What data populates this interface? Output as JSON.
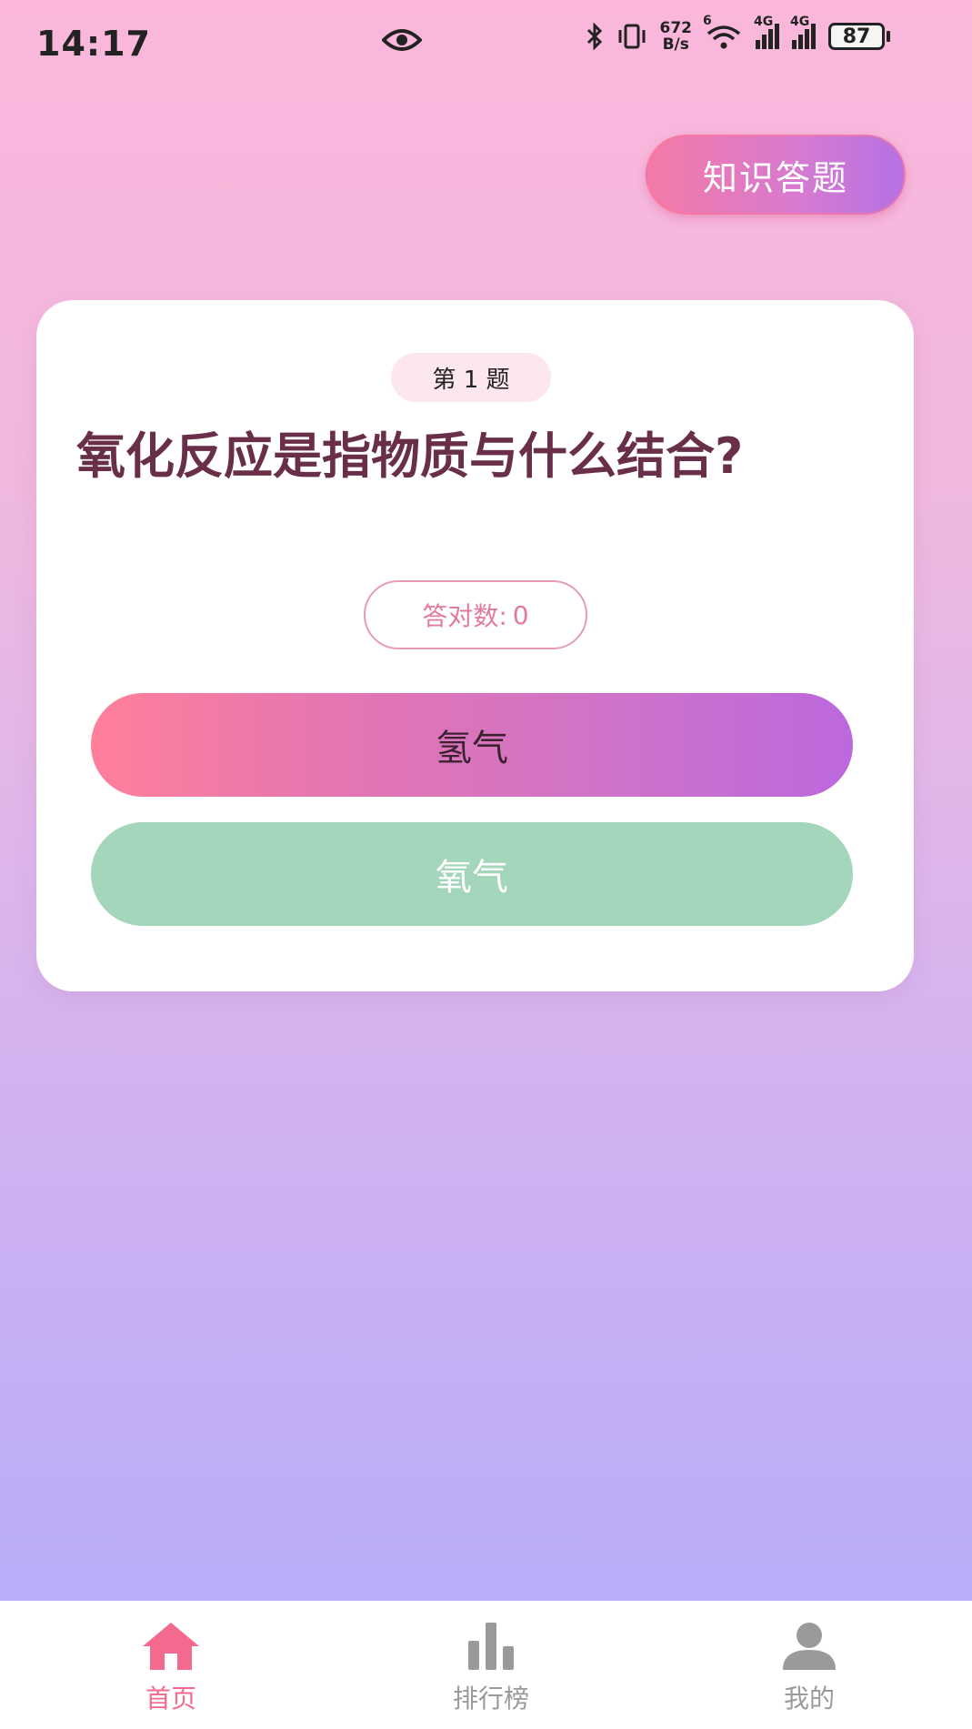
{
  "status_bar": {
    "time": "14:17",
    "net_speed_top": "672",
    "net_speed_bottom": "B/s",
    "wifi_label": "6",
    "sig1_label": "4G",
    "sig2_label": "4G",
    "battery": "87"
  },
  "header": {
    "quiz_button_label": "知识答题"
  },
  "card": {
    "question_badge": "第 1 题",
    "question_text": "氧化反应是指物质与什么结合?",
    "score_label": "答对数:",
    "score_value": "0",
    "options": [
      {
        "label": "氢气"
      },
      {
        "label": "氧气"
      }
    ]
  },
  "bottom_nav": {
    "items": [
      {
        "label": "首页",
        "icon": "home-icon",
        "active": true
      },
      {
        "label": "排行榜",
        "icon": "bar-chart-icon",
        "active": false
      },
      {
        "label": "我的",
        "icon": "user-icon",
        "active": false
      }
    ]
  },
  "colors": {
    "accent_pink": "#f46a8e",
    "question_text": "#6a2f48",
    "option_correct_green": "#a4d6bb",
    "gradient_start": "#ff7f9a",
    "gradient_end": "#bc68de"
  }
}
